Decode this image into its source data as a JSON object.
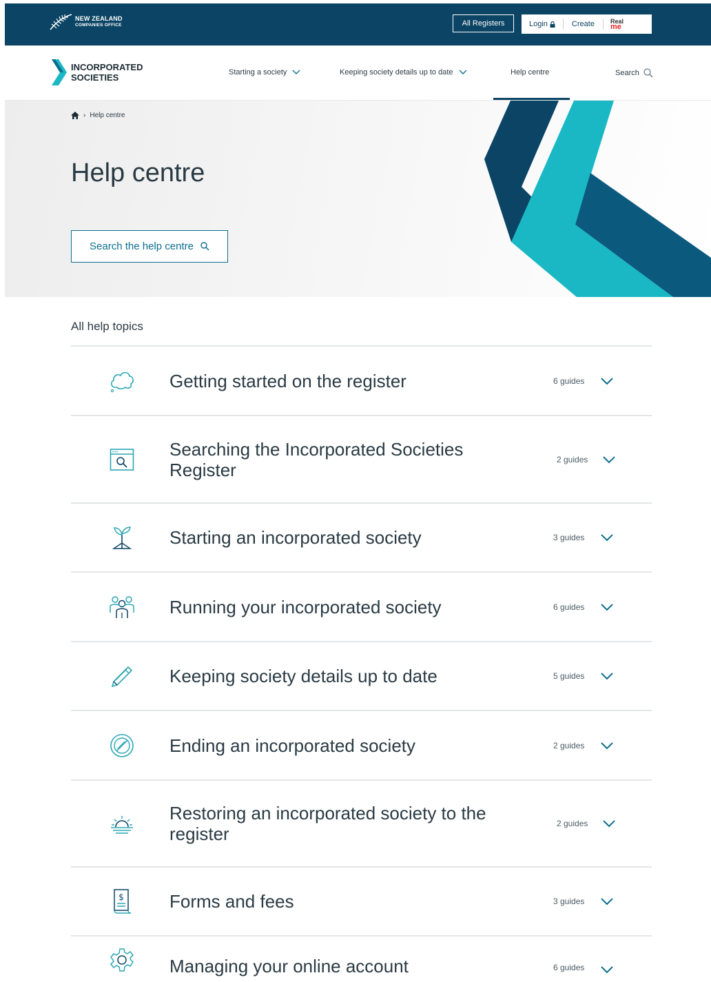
{
  "topbar": {
    "logo_line1": "NEW ZEALAND",
    "logo_line2": "COMPANIES OFFICE",
    "all_registers": "All Registers",
    "login": "Login",
    "create": "Create",
    "realme_line1": "Real",
    "realme_line2": "me",
    "colors": {
      "bar": "#0b4464"
    }
  },
  "header": {
    "brand_line1": "INCORPORATED",
    "brand_line2": "SOCIETIES",
    "nav": {
      "starting": "Starting a society",
      "keeping": "Keeping society details up to date",
      "help": "Help centre",
      "search": "Search"
    }
  },
  "hero": {
    "breadcrumb_current": "Help centre",
    "title": "Help centre",
    "search_button": "Search the help centre",
    "colors": {
      "teal": "#1ab8c4",
      "navy": "#0b4464",
      "blue": "#0b6e8e"
    }
  },
  "topics": {
    "label": "All help topics",
    "items": [
      {
        "title": "Getting started on the register",
        "count": "6 guides",
        "icon": "cloud-icon"
      },
      {
        "title": "Searching the Incorporated Societies Register",
        "count": "2 guides",
        "icon": "search-window-icon"
      },
      {
        "title": "Starting an incorporated society",
        "count": "3 guides",
        "icon": "sprout-icon"
      },
      {
        "title": "Running your incorporated society",
        "count": "6 guides",
        "icon": "people-icon"
      },
      {
        "title": "Keeping society details up to date",
        "count": "5 guides",
        "icon": "pencil-icon"
      },
      {
        "title": "Ending an incorporated society",
        "count": "2 guides",
        "icon": "prohibited-icon"
      },
      {
        "title": "Restoring an incorporated society to the register",
        "count": "2 guides",
        "icon": "sunrise-icon"
      },
      {
        "title": "Forms and fees",
        "count": "3 guides",
        "icon": "receipt-icon"
      },
      {
        "title": "Managing your online account",
        "count": "6 guides",
        "icon": "gear-icon"
      }
    ]
  }
}
